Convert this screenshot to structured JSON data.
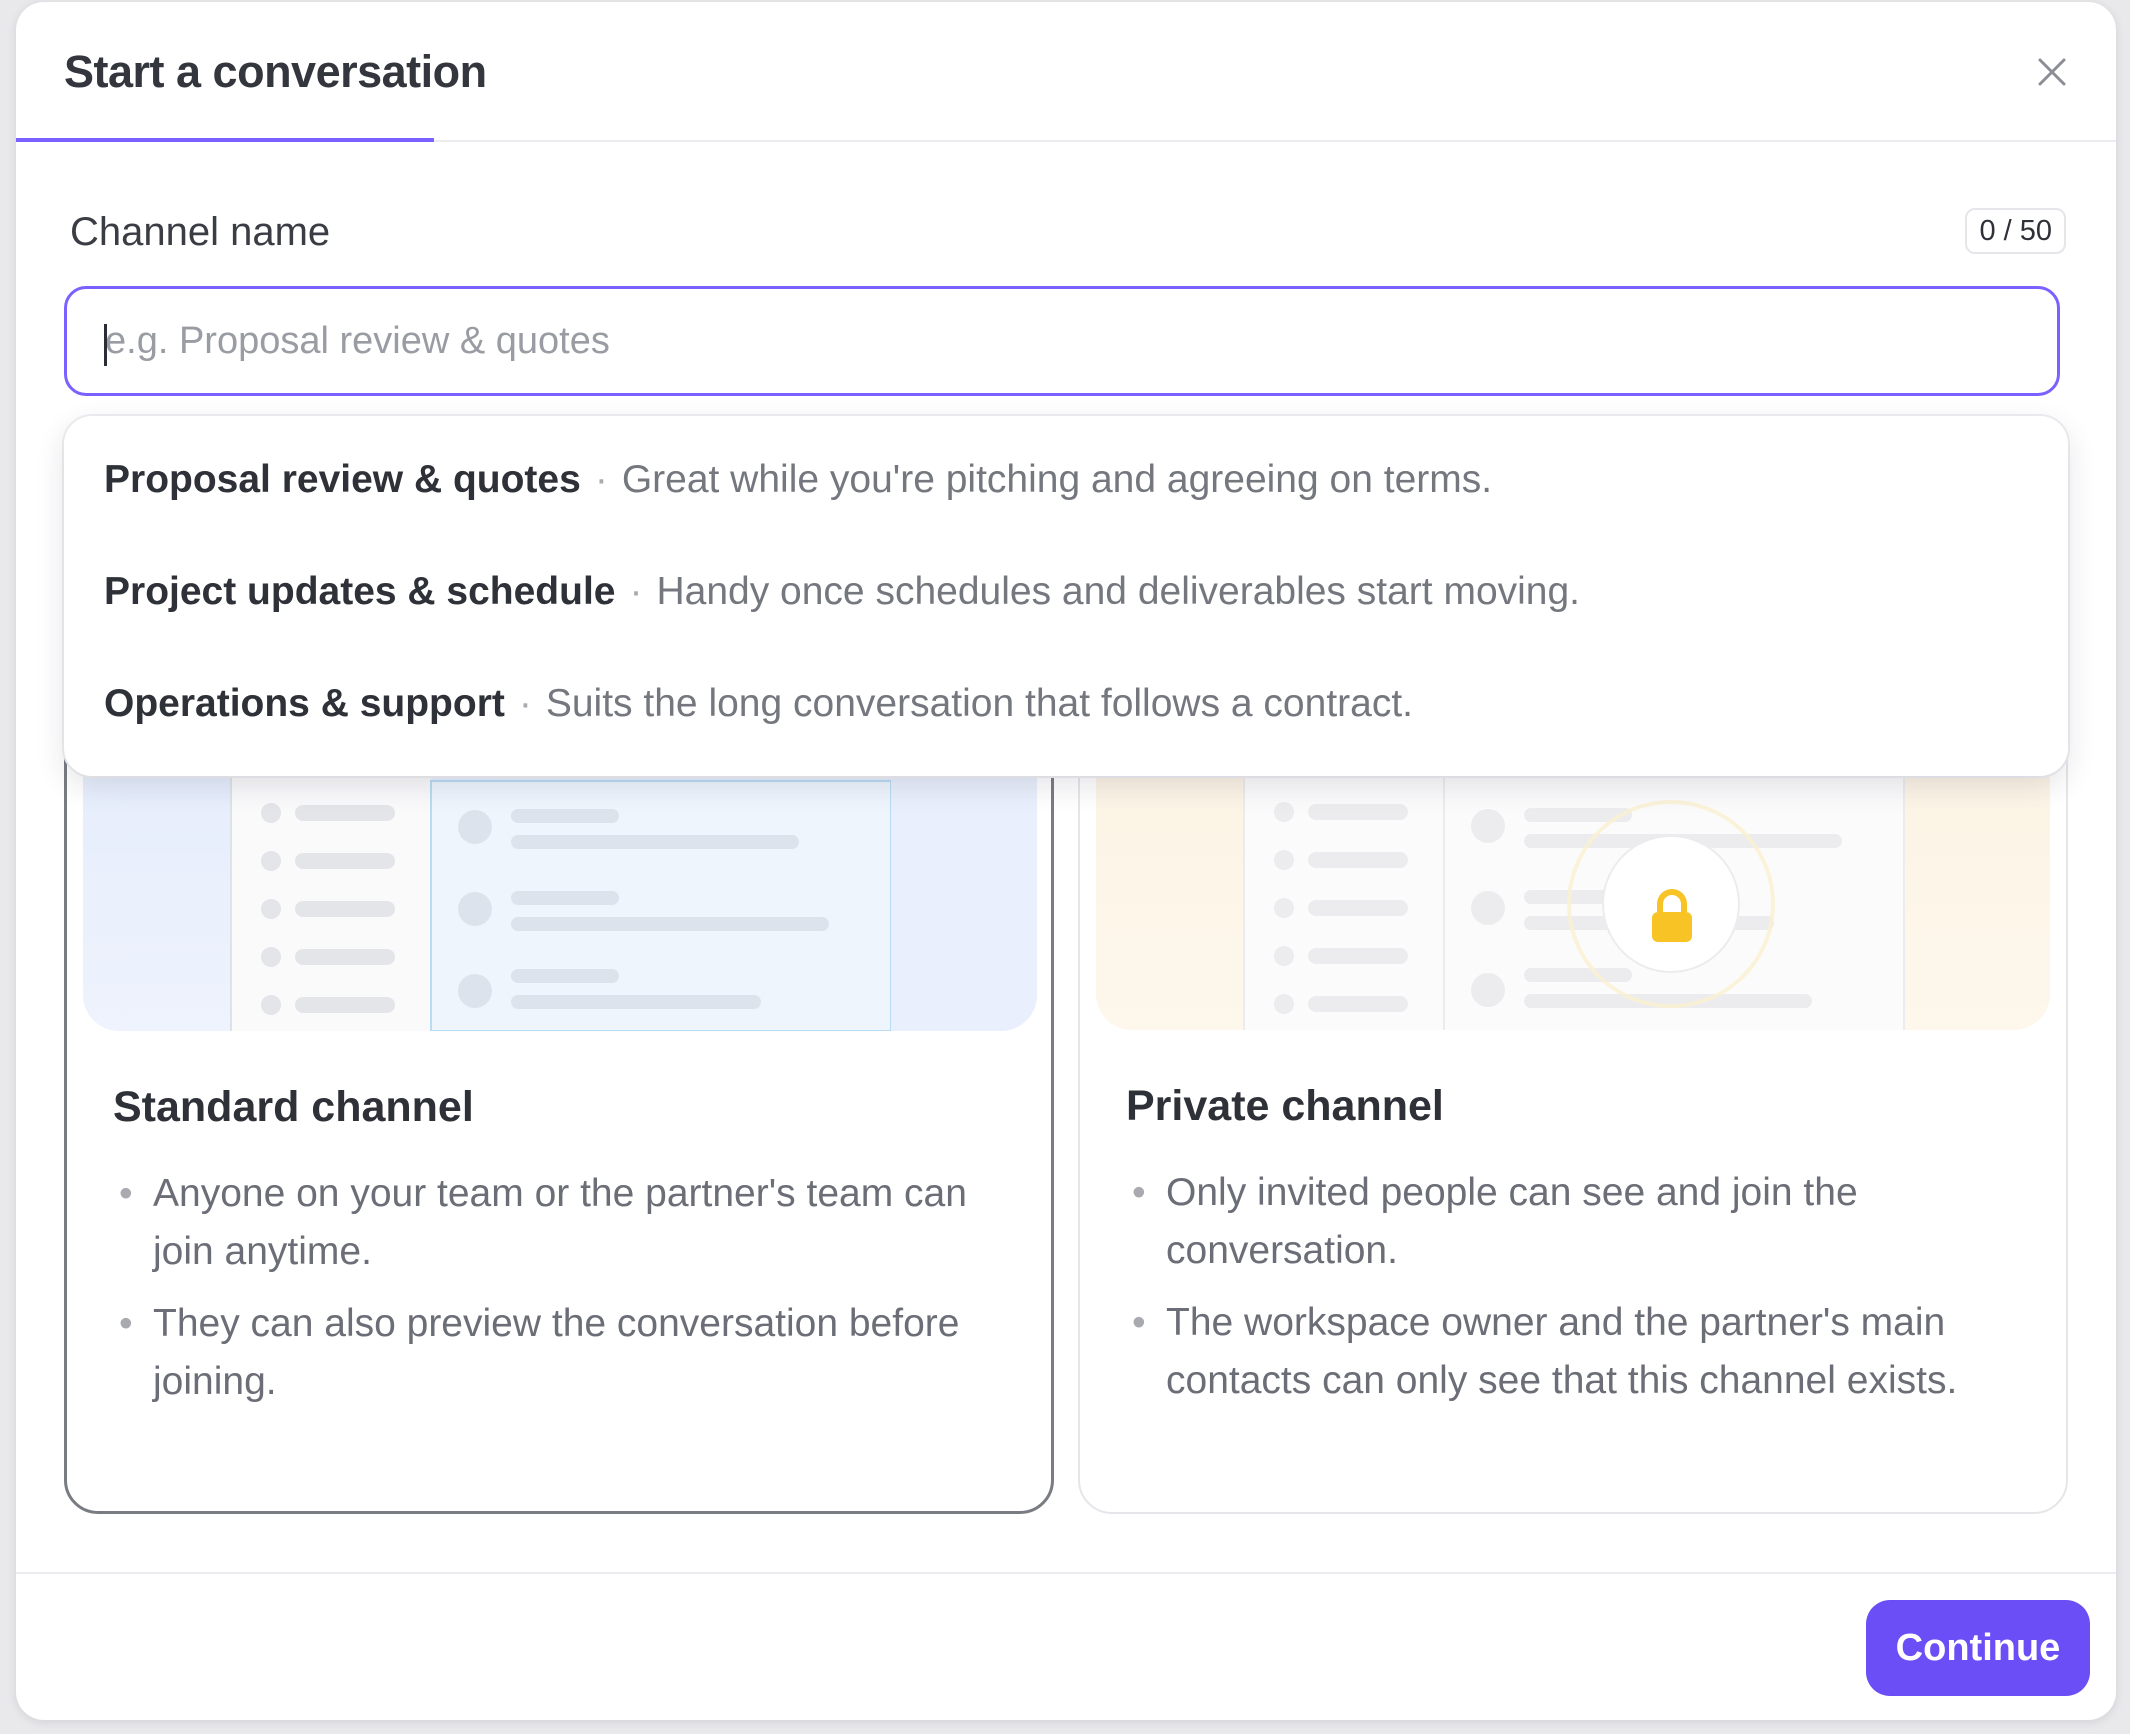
{
  "dialog": {
    "title": "Start a conversation"
  },
  "form": {
    "label": "Channel name",
    "counter": "0 / 50",
    "value": "",
    "placeholder": "e.g. Proposal review & quotes"
  },
  "suggestions": [
    {
      "name": "Proposal review & quotes",
      "desc": "Great while you're pitching and agreeing on terms."
    },
    {
      "name": "Project updates & schedule",
      "desc": "Handy once schedules and deliverables start moving."
    },
    {
      "name": "Operations & support",
      "desc": "Suits the long conversation that follows a contract."
    }
  ],
  "separator": "·",
  "cards": {
    "standard": {
      "title": "Standard channel",
      "bullets": [
        "Anyone on your team or the partner's team can join anytime.",
        "They can also preview the conversation before joining."
      ]
    },
    "private": {
      "title": "Private channel",
      "bullets": [
        "Only invited people can see and join the conversation.",
        "The workspace owner and the partner's main contacts can only see that this channel exists."
      ]
    }
  },
  "footer": {
    "continue_label": "Continue"
  },
  "colors": {
    "accent": "#7b61ff",
    "button": "#6b4ef6",
    "lock": "#f7c325"
  }
}
